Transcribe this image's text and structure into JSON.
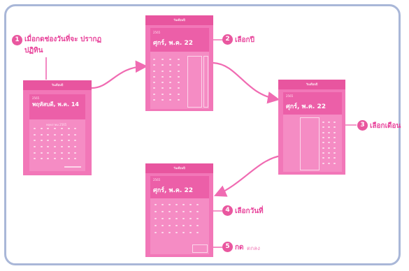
{
  "header_text": "วันเดือนปี",
  "phones": [
    {
      "year": "2565",
      "date": "พฤหัสบดี, พ.ค. 14",
      "calendar_month": "พฤษภาคม 2565"
    },
    {
      "year": "2565",
      "date": "ศุกร์, พ.ค. 22"
    },
    {
      "year": "2565",
      "date": "ศุกร์, พ.ค. 22"
    },
    {
      "year": "2565",
      "date": "ศุกร์, พ.ค. 22"
    }
  ],
  "steps": [
    {
      "num": "1",
      "label": "เมื่อกดช่องวันที่จะ ปรากฏปฏิทิน"
    },
    {
      "num": "2",
      "label": "เลือกปี"
    },
    {
      "num": "3",
      "label": "เลือกเดือน"
    },
    {
      "num": "4",
      "label": "เลือกวันที่"
    },
    {
      "num": "5",
      "label": "กด",
      "follow": "ตกลง"
    }
  ],
  "colors": {
    "accent": "#e8429a",
    "phone": "#f277b8",
    "arrow": "#f06bb2",
    "frame": "#a9b7d8"
  }
}
